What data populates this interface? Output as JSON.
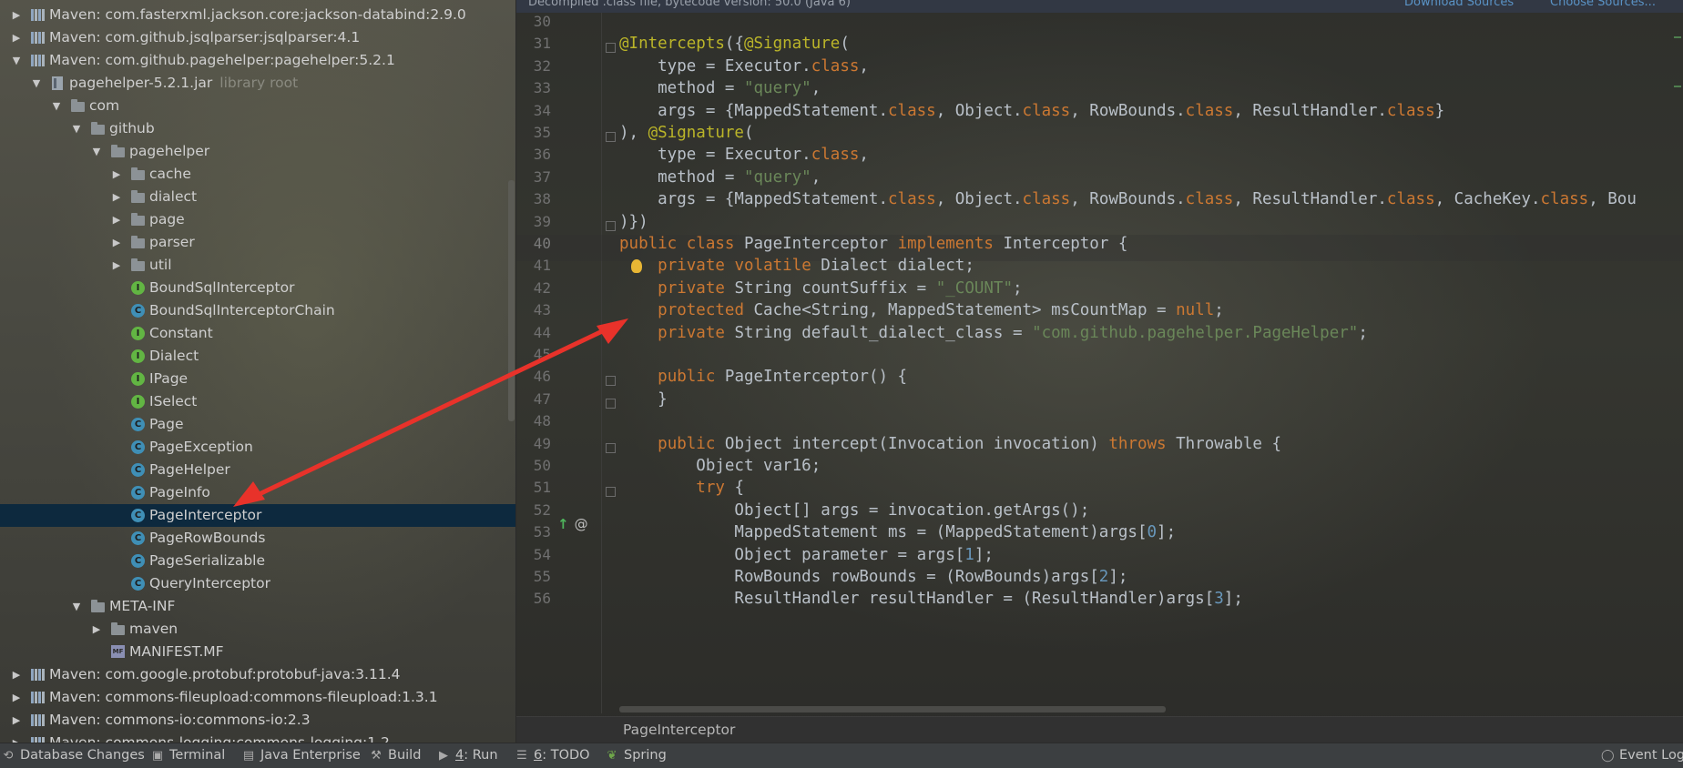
{
  "tree": {
    "rows": [
      {
        "arrow": "▶",
        "icon": "lib",
        "label": "Maven: com.fasterxml.jackson.core:jackson-databind:2.9.0"
      },
      {
        "arrow": "▶",
        "icon": "lib",
        "label": "Maven: com.github.jsqlparser:jsqlparser:4.1"
      },
      {
        "arrow": "▼",
        "icon": "lib",
        "label": "Maven: com.github.pagehelper:pagehelper:5.2.1"
      },
      {
        "arrow": "▼",
        "icon": "jar",
        "label": "pagehelper-5.2.1.jar",
        "hint": "library root"
      },
      {
        "arrow": "▼",
        "icon": "folder",
        "label": "com"
      },
      {
        "arrow": "▼",
        "icon": "folder",
        "label": "github"
      },
      {
        "arrow": "▼",
        "icon": "folder",
        "label": "pagehelper"
      },
      {
        "arrow": "▶",
        "icon": "folder",
        "label": "cache"
      },
      {
        "arrow": "▶",
        "icon": "folder",
        "label": "dialect"
      },
      {
        "arrow": "▶",
        "icon": "folder",
        "label": "page"
      },
      {
        "arrow": "▶",
        "icon": "folder",
        "label": "parser"
      },
      {
        "arrow": "▶",
        "icon": "folder",
        "label": "util"
      },
      {
        "arrow": "",
        "icon": "itf",
        "label": "BoundSqlInterceptor"
      },
      {
        "arrow": "",
        "icon": "cls",
        "label": "BoundSqlInterceptorChain"
      },
      {
        "arrow": "",
        "icon": "itf",
        "label": "Constant"
      },
      {
        "arrow": "",
        "icon": "itf",
        "label": "Dialect"
      },
      {
        "arrow": "",
        "icon": "itf",
        "label": "IPage"
      },
      {
        "arrow": "",
        "icon": "itf",
        "label": "ISelect"
      },
      {
        "arrow": "",
        "icon": "cls",
        "label": "Page"
      },
      {
        "arrow": "",
        "icon": "cls",
        "label": "PageException"
      },
      {
        "arrow": "",
        "icon": "cls",
        "label": "PageHelper"
      },
      {
        "arrow": "",
        "icon": "cls",
        "label": "PageInfo"
      },
      {
        "arrow": "",
        "icon": "cls",
        "label": "PageInterceptor",
        "selected": true
      },
      {
        "arrow": "",
        "icon": "cls",
        "label": "PageRowBounds"
      },
      {
        "arrow": "",
        "icon": "cls",
        "label": "PageSerializable"
      },
      {
        "arrow": "",
        "icon": "cls",
        "label": "QueryInterceptor"
      },
      {
        "arrow": "▼",
        "icon": "folder",
        "label": "META-INF"
      },
      {
        "arrow": "▶",
        "icon": "folder",
        "label": "maven"
      },
      {
        "arrow": "",
        "icon": "mf",
        "label": "MANIFEST.MF"
      },
      {
        "arrow": "▶",
        "icon": "lib",
        "label": "Maven: com.google.protobuf:protobuf-java:3.11.4"
      },
      {
        "arrow": "▶",
        "icon": "lib",
        "label": "Maven: commons-fileupload:commons-fileupload:1.3.1"
      },
      {
        "arrow": "▶",
        "icon": "lib",
        "label": "Maven: commons-io:commons-io:2.3"
      },
      {
        "arrow": "▶",
        "icon": "lib",
        "label": "Maven: commons-logging:commons-logging:1.2"
      }
    ]
  },
  "editor": {
    "banner_text": "Decompiled .class file, bytecode version: 50.0 (Java 6)",
    "banner_link_1": "Download Sources",
    "banner_link_2": "Choose Sources...",
    "lines": [
      {
        "n": "30",
        "code": ""
      },
      {
        "n": "31",
        "code": "@Intercepts({@Signature("
      },
      {
        "n": "32",
        "code": "    type = Executor.class,"
      },
      {
        "n": "33",
        "code": "    method = \"query\","
      },
      {
        "n": "34",
        "code": "    args = {MappedStatement.class, Object.class, RowBounds.class, ResultHandler.class}"
      },
      {
        "n": "35",
        "code": "), @Signature("
      },
      {
        "n": "36",
        "code": "    type = Executor.class,"
      },
      {
        "n": "37",
        "code": "    method = \"query\","
      },
      {
        "n": "38",
        "code": "    args = {MappedStatement.class, Object.class, RowBounds.class, ResultHandler.class, CacheKey.class, Bou"
      },
      {
        "n": "39",
        "code": ")})"
      },
      {
        "n": "40",
        "code": "public class PageInterceptor implements Interceptor {"
      },
      {
        "n": "41",
        "code": "    private volatile Dialect dialect;"
      },
      {
        "n": "42",
        "code": "    private String countSuffix = \"_COUNT\";"
      },
      {
        "n": "43",
        "code": "    protected Cache<String, MappedStatement> msCountMap = null;"
      },
      {
        "n": "44",
        "code": "    private String default_dialect_class = \"com.github.pagehelper.PageHelper\";"
      },
      {
        "n": "45",
        "code": ""
      },
      {
        "n": "46",
        "code": "    public PageInterceptor() {"
      },
      {
        "n": "47",
        "code": "    }"
      },
      {
        "n": "48",
        "code": ""
      },
      {
        "n": "49",
        "code": "    public Object intercept(Invocation invocation) throws Throwable {"
      },
      {
        "n": "50",
        "code": "        Object var16;"
      },
      {
        "n": "51",
        "code": "        try {"
      },
      {
        "n": "52",
        "code": "            Object[] args = invocation.getArgs();"
      },
      {
        "n": "53",
        "code": "            MappedStatement ms = (MappedStatement)args[0];"
      },
      {
        "n": "54",
        "code": "            Object parameter = args[1];"
      },
      {
        "n": "55",
        "code": "            RowBounds rowBounds = (RowBounds)args[2];"
      },
      {
        "n": "56",
        "code": "            ResultHandler resultHandler = (ResultHandler)args[3];"
      }
    ],
    "current_line": "40",
    "gutter_icons": "@",
    "breadcrumb": "PageInterceptor"
  },
  "statusbar": {
    "database_changes": "Database Changes",
    "terminal": "Terminal",
    "java_enterprise": "Java Enterprise",
    "build": "Build",
    "run_num": "4",
    "run": ": Run",
    "todo_num": "6",
    "todo": ": TODO",
    "spring": "Spring",
    "event_log": "Event Log"
  },
  "colors": {
    "keyword": "#cc7832",
    "string": "#6a8759",
    "annotation": "#bbb529",
    "number": "#6897bb",
    "selection": "#0d293e",
    "arrow": "#e8322a"
  }
}
